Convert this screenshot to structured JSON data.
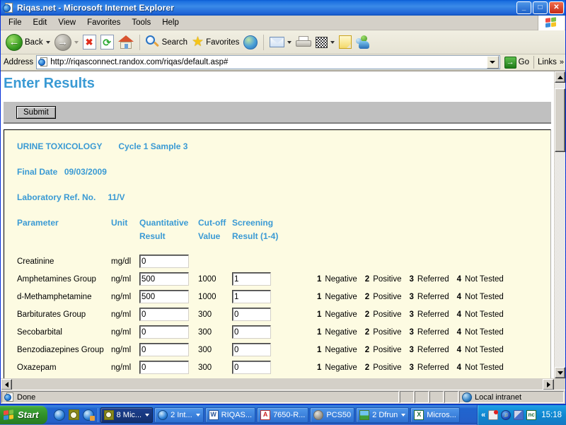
{
  "window": {
    "title": "Riqas.net - Microsoft Internet Explorer",
    "icon": "ie-document-icon",
    "minimize_label": "_",
    "maximize_label": "□",
    "close_label": "✕"
  },
  "menubar": {
    "items": [
      {
        "label": "File"
      },
      {
        "label": "Edit"
      },
      {
        "label": "View"
      },
      {
        "label": "Favorites"
      },
      {
        "label": "Tools"
      },
      {
        "label": "Help"
      }
    ],
    "brand_icon": "windows-flag-icon"
  },
  "toolbar": {
    "back_label": "Back",
    "back_icon": "back-arrow-icon",
    "forward_icon": "forward-arrow-icon",
    "stop_icon": "stop-icon",
    "stop_glyph": "✖",
    "refresh_icon": "refresh-icon",
    "refresh_glyph": "⟳",
    "home_icon": "home-icon",
    "search_label": "Search",
    "search_icon": "search-icon",
    "favorites_label": "Favorites",
    "favorites_icon": "star-icon",
    "history_icon": "history-icon",
    "mail_icon": "mail-icon",
    "print_icon": "printer-icon",
    "edit_icon": "edit-page-icon",
    "notes_icon": "notes-icon",
    "messenger_icon": "messenger-icon",
    "back_glyph": "←",
    "forward_glyph": "→"
  },
  "address_bar": {
    "label": "Address",
    "icon": "ie-document-icon",
    "url": "http://riqasconnect.randox.com/riqas/default.asp#",
    "placeholder": "",
    "go_label": "Go",
    "go_glyph": "→",
    "links_label": "Links",
    "chevron": "»"
  },
  "page": {
    "heading": "Enter Results",
    "submit_label": "Submit",
    "survey_name": "URINE TOXICOLOGY",
    "cycle_sample": "Cycle 1 Sample 3",
    "final_date_label": "Final Date",
    "final_date_value": "09/03/2009",
    "lab_ref_label": "Laboratory Ref. No.",
    "lab_ref_value": "11/V",
    "columns": {
      "parameter": "Parameter",
      "unit": "Unit",
      "quantitative_line1": "Quantitative",
      "quantitative_line2": "Result",
      "cutoff_line1": "Cut-off",
      "cutoff_line2": "Value",
      "screening_line1": "Screening",
      "screening_line2": "Result (1-4)"
    },
    "legend": [
      {
        "code": "1",
        "label": "Negative"
      },
      {
        "code": "2",
        "label": "Positive"
      },
      {
        "code": "3",
        "label": "Referred"
      },
      {
        "code": "4",
        "label": "Not Tested"
      }
    ],
    "rows": [
      {
        "parameter": "Creatinine",
        "unit": "mg/dl",
        "quantitative": "0",
        "cutoff": "",
        "screening": null,
        "show_legend": false
      },
      {
        "parameter": "Amphetamines Group",
        "unit": "ng/ml",
        "quantitative": "500",
        "cutoff": "1000",
        "screening": "1",
        "show_legend": true
      },
      {
        "parameter": "d-Methamphetamine",
        "unit": "ng/ml",
        "quantitative": "500",
        "cutoff": "1000",
        "screening": "1",
        "show_legend": true
      },
      {
        "parameter": "Barbiturates Group",
        "unit": "ng/ml",
        "quantitative": "0",
        "cutoff": "300",
        "screening": "0",
        "show_legend": true
      },
      {
        "parameter": "Secobarbital",
        "unit": "ng/ml",
        "quantitative": "0",
        "cutoff": "300",
        "screening": "0",
        "show_legend": true
      },
      {
        "parameter": "Benzodiazepines Group",
        "unit": "ng/ml",
        "quantitative": "0",
        "cutoff": "300",
        "screening": "0",
        "show_legend": true
      },
      {
        "parameter": "Oxazepam",
        "unit": "ng/ml",
        "quantitative": "0",
        "cutoff": "300",
        "screening": "0",
        "show_legend": true
      }
    ]
  },
  "statusbar": {
    "text": "Done",
    "icon": "ie-document-icon",
    "zone_label": "Local intranet",
    "zone_icon": "globe-icon"
  },
  "taskbar": {
    "start_label": "Start",
    "start_icon": "windows-flag-icon",
    "quicklaunch": [
      {
        "name": "launch-ie-icon"
      },
      {
        "name": "launch-clock-icon"
      },
      {
        "name": "launch-ie-mail-icon"
      }
    ],
    "tasks": [
      {
        "label": "8 Mic...",
        "icon": "clock-icon",
        "active": true,
        "group": true
      },
      {
        "label": "2 Int...",
        "icon": "ie-icon",
        "active": false,
        "group": true
      },
      {
        "label": "RIQAS...",
        "icon": "word-icon",
        "active": false,
        "group": false
      },
      {
        "label": "7650-R...",
        "icon": "pdf-icon",
        "active": false,
        "group": false
      },
      {
        "label": "PCS50",
        "icon": "app-icon",
        "active": false,
        "group": false
      },
      {
        "label": "2 Dfrun",
        "icon": "picture-icon",
        "active": false,
        "group": true
      },
      {
        "label": "Micros...",
        "icon": "excel-icon",
        "active": false,
        "group": false
      }
    ],
    "tray": {
      "chevron": "«",
      "icons": [
        {
          "name": "network-alert-icon"
        },
        {
          "name": "sound-volume-icon"
        },
        {
          "name": "network-connection-icon"
        },
        {
          "name": "nc-app-icon"
        }
      ],
      "clock": "15:18"
    }
  },
  "colors": {
    "heading_blue": "#3a9ad4",
    "panel_cream": "#fdfbe2",
    "chrome_gray": "#d4d0c8",
    "title_blue": "#1e63d6"
  }
}
